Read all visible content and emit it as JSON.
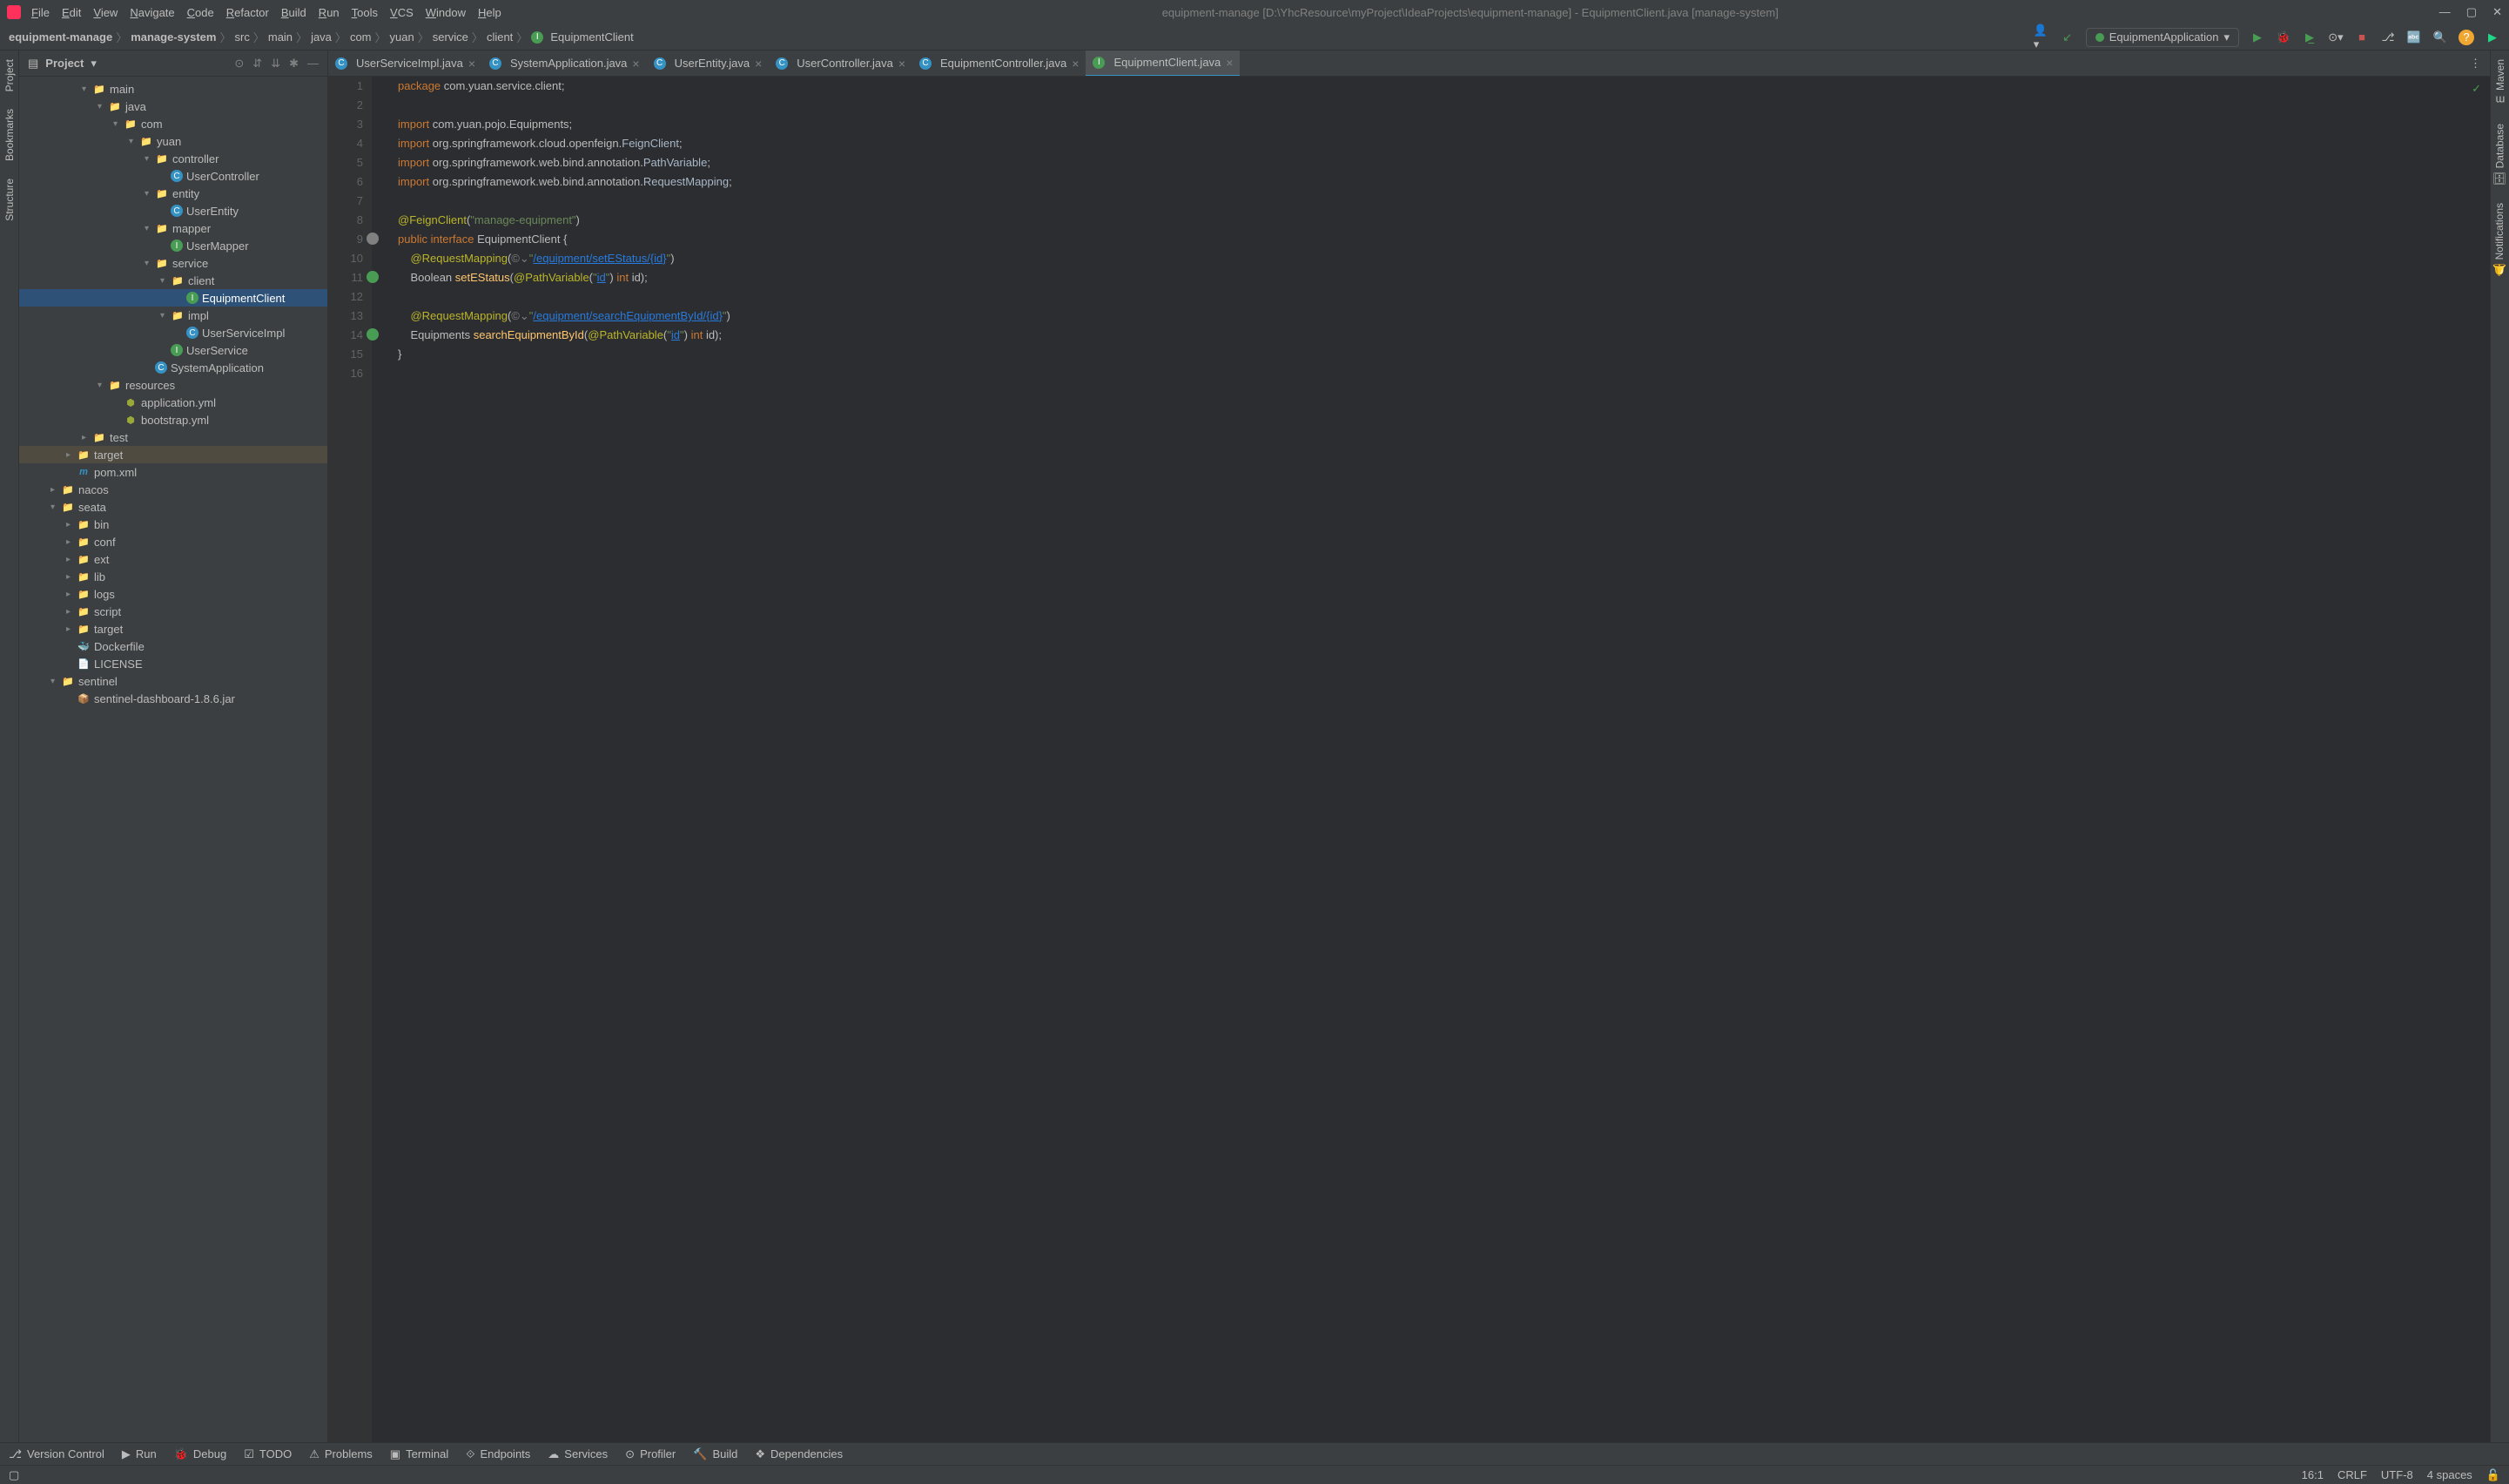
{
  "title": "equipment-manage [D:\\YhcResource\\myProject\\IdeaProjects\\equipment-manage] - EquipmentClient.java [manage-system]",
  "menu": [
    "File",
    "Edit",
    "View",
    "Navigate",
    "Code",
    "Refactor",
    "Build",
    "Run",
    "Tools",
    "VCS",
    "Window",
    "Help"
  ],
  "breadcrumb": [
    "equipment-manage",
    "manage-system",
    "src",
    "main",
    "java",
    "com",
    "yuan",
    "service",
    "client",
    "EquipmentClient"
  ],
  "run_config": "EquipmentApplication",
  "panel_title": "Project",
  "tree": [
    {
      "indent": 4,
      "arrow": "▾",
      "icon": "folder-blue",
      "label": "main"
    },
    {
      "indent": 5,
      "arrow": "▾",
      "icon": "folder-blue",
      "label": "java"
    },
    {
      "indent": 6,
      "arrow": "▾",
      "icon": "folder",
      "label": "com"
    },
    {
      "indent": 7,
      "arrow": "▾",
      "icon": "folder",
      "label": "yuan"
    },
    {
      "indent": 8,
      "arrow": "▾",
      "icon": "folder",
      "label": "controller"
    },
    {
      "indent": 9,
      "arrow": "",
      "icon": "class",
      "label": "UserController"
    },
    {
      "indent": 8,
      "arrow": "▾",
      "icon": "folder",
      "label": "entity"
    },
    {
      "indent": 9,
      "arrow": "",
      "icon": "class",
      "label": "UserEntity"
    },
    {
      "indent": 8,
      "arrow": "▾",
      "icon": "folder",
      "label": "mapper"
    },
    {
      "indent": 9,
      "arrow": "",
      "icon": "interface",
      "label": "UserMapper"
    },
    {
      "indent": 8,
      "arrow": "▾",
      "icon": "folder",
      "label": "service"
    },
    {
      "indent": 9,
      "arrow": "▾",
      "icon": "folder",
      "label": "client"
    },
    {
      "indent": 10,
      "arrow": "",
      "icon": "interface",
      "label": "EquipmentClient",
      "selected": true
    },
    {
      "indent": 9,
      "arrow": "▾",
      "icon": "folder",
      "label": "impl"
    },
    {
      "indent": 10,
      "arrow": "",
      "icon": "class",
      "label": "UserServiceImpl"
    },
    {
      "indent": 9,
      "arrow": "",
      "icon": "interface",
      "label": "UserService"
    },
    {
      "indent": 8,
      "arrow": "",
      "icon": "class-run",
      "label": "SystemApplication"
    },
    {
      "indent": 5,
      "arrow": "▾",
      "icon": "folder-res",
      "label": "resources"
    },
    {
      "indent": 6,
      "arrow": "",
      "icon": "yml",
      "label": "application.yml"
    },
    {
      "indent": 6,
      "arrow": "",
      "icon": "yml",
      "label": "bootstrap.yml"
    },
    {
      "indent": 4,
      "arrow": "▸",
      "icon": "folder",
      "label": "test"
    },
    {
      "indent": 3,
      "arrow": "▸",
      "icon": "folder-orange",
      "label": "target",
      "highlighted": true
    },
    {
      "indent": 3,
      "arrow": "",
      "icon": "maven",
      "label": "pom.xml"
    },
    {
      "indent": 2,
      "arrow": "▸",
      "icon": "folder",
      "label": "nacos"
    },
    {
      "indent": 2,
      "arrow": "▾",
      "icon": "folder",
      "label": "seata"
    },
    {
      "indent": 3,
      "arrow": "▸",
      "icon": "folder",
      "label": "bin"
    },
    {
      "indent": 3,
      "arrow": "▸",
      "icon": "folder",
      "label": "conf"
    },
    {
      "indent": 3,
      "arrow": "▸",
      "icon": "folder",
      "label": "ext"
    },
    {
      "indent": 3,
      "arrow": "▸",
      "icon": "folder",
      "label": "lib"
    },
    {
      "indent": 3,
      "arrow": "▸",
      "icon": "folder",
      "label": "logs"
    },
    {
      "indent": 3,
      "arrow": "▸",
      "icon": "folder",
      "label": "script"
    },
    {
      "indent": 3,
      "arrow": "▸",
      "icon": "folder",
      "label": "target"
    },
    {
      "indent": 3,
      "arrow": "",
      "icon": "docker",
      "label": "Dockerfile"
    },
    {
      "indent": 3,
      "arrow": "",
      "icon": "file",
      "label": "LICENSE"
    },
    {
      "indent": 2,
      "arrow": "▾",
      "icon": "folder",
      "label": "sentinel"
    },
    {
      "indent": 3,
      "arrow": "",
      "icon": "jar",
      "label": "sentinel-dashboard-1.8.6.jar"
    }
  ],
  "tabs": [
    {
      "icon": "class",
      "label": "UserServiceImpl.java"
    },
    {
      "icon": "class-run",
      "label": "SystemApplication.java"
    },
    {
      "icon": "class",
      "label": "UserEntity.java"
    },
    {
      "icon": "class",
      "label": "UserController.java"
    },
    {
      "icon": "class",
      "label": "EquipmentController.java"
    },
    {
      "icon": "interface",
      "label": "EquipmentClient.java",
      "active": true
    }
  ],
  "code_lines": [
    {
      "n": 1,
      "html": "<span class='kw'>package</span> com.yuan.service.client;"
    },
    {
      "n": 2,
      "html": ""
    },
    {
      "n": 3,
      "html": "<span class='kw'>import</span> com.yuan.pojo.Equipments;"
    },
    {
      "n": 4,
      "html": "<span class='kw'>import</span> org.springframework.cloud.openfeign.<span class='cls'>FeignClient</span>;"
    },
    {
      "n": 5,
      "html": "<span class='kw'>import</span> org.springframework.web.bind.annotation.<span class='cls'>PathVariable</span>;"
    },
    {
      "n": 6,
      "html": "<span class='kw'>import</span> org.springframework.web.bind.annotation.<span class='cls'>RequestMapping</span>;"
    },
    {
      "n": 7,
      "html": ""
    },
    {
      "n": 8,
      "html": "<span class='anno'>@FeignClient</span>(<span class='str'>\"manage-equipment\"</span>)"
    },
    {
      "n": 9,
      "html": "<span class='kw'>public interface</span> EquipmentClient {",
      "marker": "impl"
    },
    {
      "n": 10,
      "html": "    <span class='anno'>@RequestMapping</span>(<span class='comment'>©⌄</span><span class='str'>\"</span><span class='url'>/equipment/setEStatus/{id}</span><span class='str'>\"</span>)"
    },
    {
      "n": 11,
      "html": "    Boolean <span class='method'>setEStatus</span>(<span class='anno'>@PathVariable</span>(<span class='str'>\"</span><span class='url'>id</span><span class='str'>\"</span>) <span class='kw'>int</span> id);",
      "marker": "web"
    },
    {
      "n": 12,
      "html": ""
    },
    {
      "n": 13,
      "html": "    <span class='anno'>@RequestMapping</span>(<span class='comment'>©⌄</span><span class='str'>\"</span><span class='url'>/equipment/searchEquipmentById/{id}</span><span class='str'>\"</span>)"
    },
    {
      "n": 14,
      "html": "    Equipments <span class='method'>searchEquipmentById</span>(<span class='anno'>@PathVariable</span>(<span class='str'>\"</span><span class='url'>id</span><span class='str'>\"</span>) <span class='kw'>int</span> id);",
      "marker": "web"
    },
    {
      "n": 15,
      "html": "}"
    },
    {
      "n": 16,
      "html": ""
    }
  ],
  "left_tools": [
    "Project",
    "Bookmarks",
    "Structure"
  ],
  "right_tools": [
    "Maven",
    "Database",
    "Notifications"
  ],
  "bottom_tools": [
    "Version Control",
    "Run",
    "Debug",
    "TODO",
    "Problems",
    "Terminal",
    "Endpoints",
    "Services",
    "Profiler",
    "Build",
    "Dependencies"
  ],
  "status": {
    "pos": "16:1",
    "eol": "CRLF",
    "enc": "UTF-8",
    "indent": "4 spaces"
  }
}
